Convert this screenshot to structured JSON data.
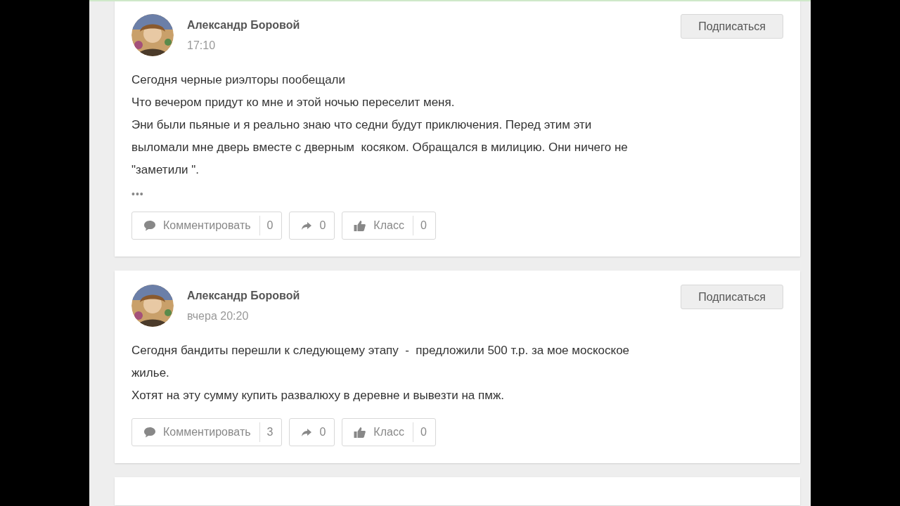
{
  "posts": [
    {
      "author": "Александр Боровой",
      "time": "17:10",
      "subscribe": "Подписаться",
      "text": "Сегодня черные риэлторы пообещали\nЧто вечером придут ко мне и этой ночью переселит меня.\nЭни были пьяные и я реально знаю что седни будут приключения. Перед этим эти\nвыломали мне дверь вместе с дверным  косяком. Обращался в милицию. Они ничего не\n\"заметили \".",
      "more": "•••",
      "actions": [
        {
          "kind": "comment",
          "label": "Комментировать",
          "count": "0"
        },
        {
          "kind": "share",
          "count": "0"
        },
        {
          "kind": "like",
          "label": "Класс",
          "count": "0"
        }
      ]
    },
    {
      "author": "Александр Боровой",
      "time": "вчера 20:20",
      "subscribe": "Подписаться",
      "text": "Сегодня бандиты перешли к следующему этапу  -  предложили 500 т.р. за мое москоское\nжилье.\nХотят на эту сумму купить развалюху в деревне и вывезти на пмж.",
      "actions": [
        {
          "kind": "comment",
          "label": "Комментировать",
          "count": "3"
        },
        {
          "kind": "share",
          "count": "0"
        },
        {
          "kind": "like",
          "label": "Класс",
          "count": "0"
        }
      ]
    }
  ]
}
